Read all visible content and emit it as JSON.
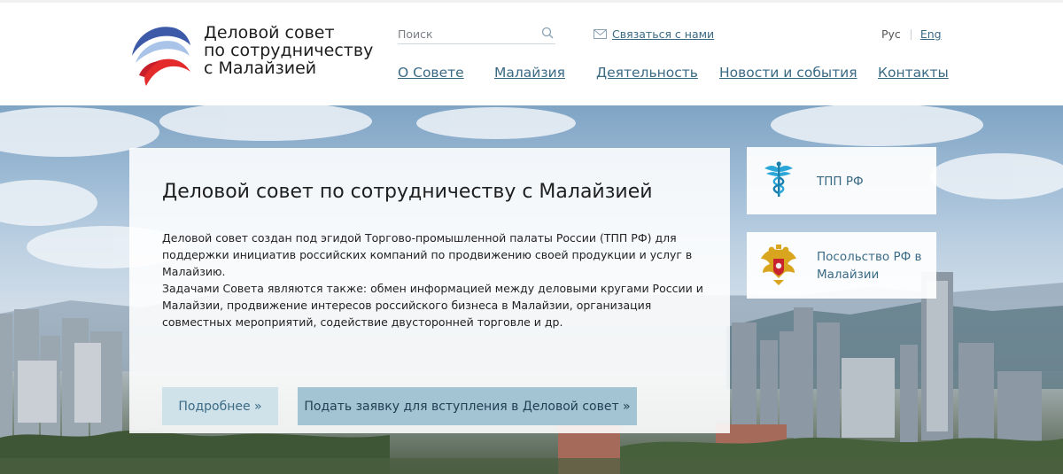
{
  "brand": {
    "name_lines": [
      "Деловой совет",
      "по сотрудничеству",
      "с Малайзией"
    ],
    "logo_icon": "council-logo-icon"
  },
  "search": {
    "placeholder": "Поиск",
    "value": "",
    "icon": "search-icon"
  },
  "contact": {
    "label": "Связаться с нами",
    "icon": "mail-icon"
  },
  "lang": {
    "ru": "Рус",
    "en": "Eng"
  },
  "nav": {
    "items": [
      "О Совете",
      "Малайзия",
      "Деятельность",
      "Новости и события",
      "Контакты"
    ]
  },
  "hero": {
    "title": "Деловой совет по сотрудничеству с Малайзией",
    "paragraph1": "Деловой совет создан под эгидой Торгово-промышленной палаты России (ТПП РФ) для поддержки инициатив российских компаний по продвижению своей продукции и услуг в Малайзию.",
    "paragraph2": "Задачами Совета являются также: обмен информацией между деловыми кругами России и Малайзии, продвижение интересов российского бизнеса в Малайзии, организация совместных мероприятий, содействие двусторонней торговле и др.",
    "more_button": "Подробнее »",
    "join_button": "Подать заявку для вступления в Деловой совет »"
  },
  "side_links": [
    {
      "label": "ТПП РФ",
      "icon": "caduceus-icon"
    },
    {
      "label": "Посольство РФ в Малайзии",
      "icon": "russian-coat-of-arms-icon"
    }
  ],
  "colors": {
    "link": "#3b6a85",
    "button_light": "#cfe2ea",
    "button_accent": "#a3c5d3"
  }
}
